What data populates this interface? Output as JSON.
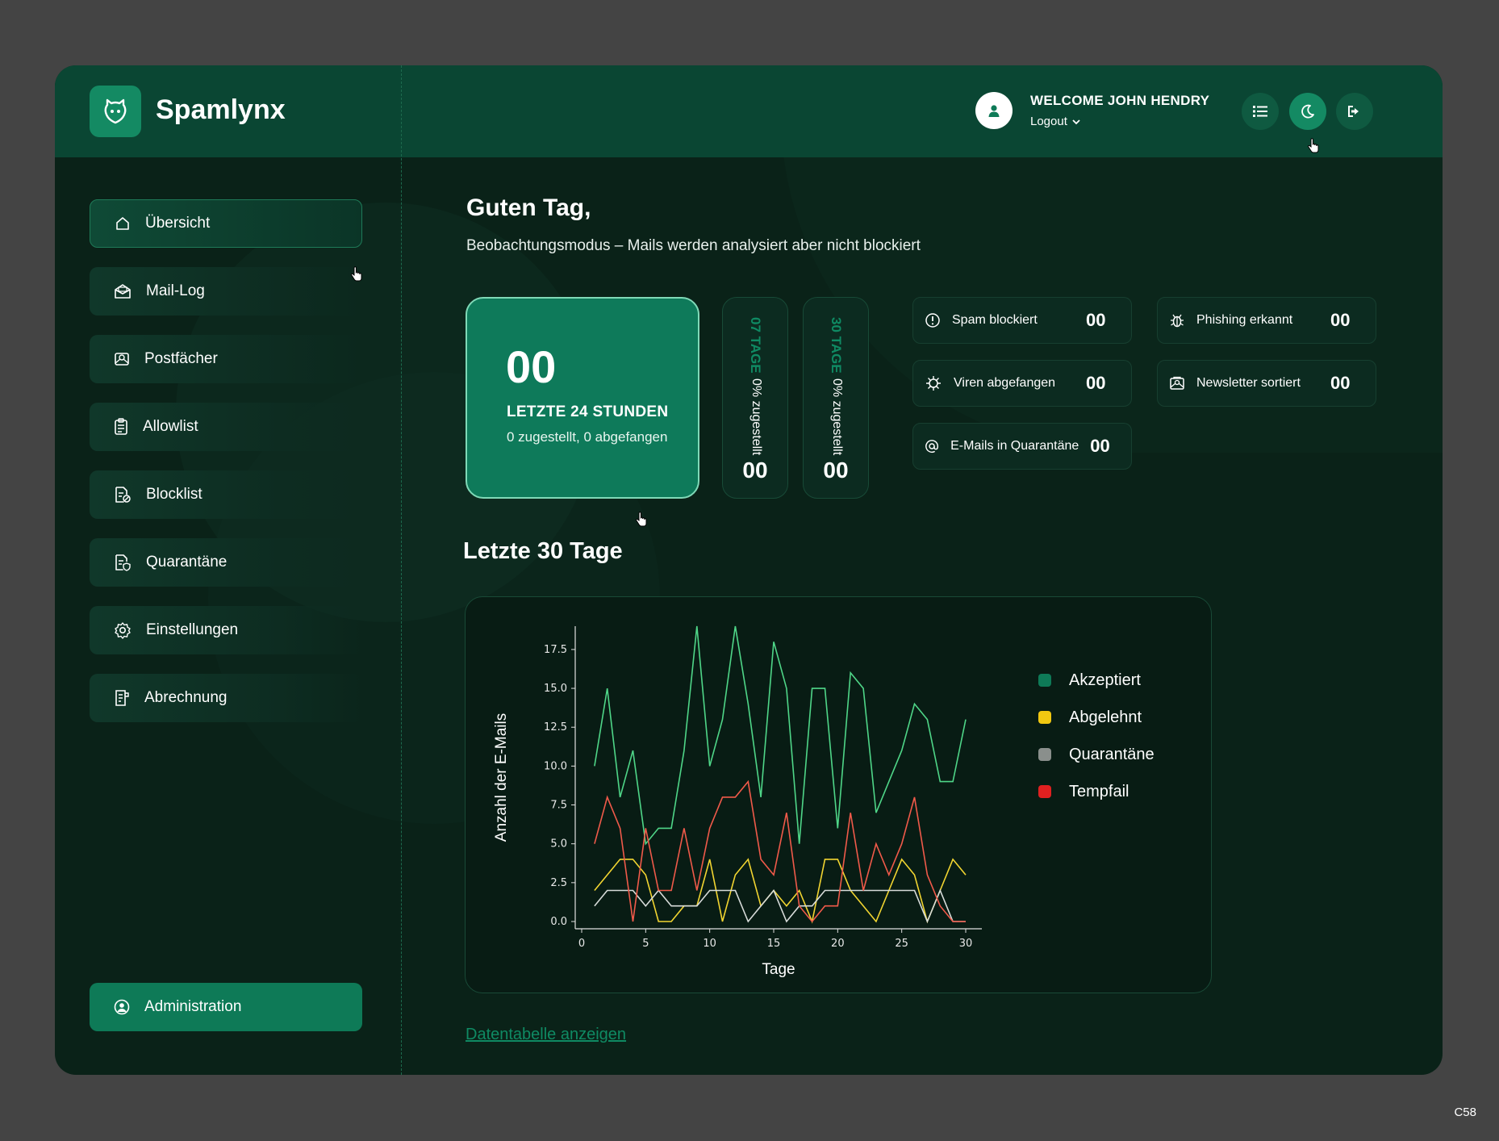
{
  "app": {
    "name": "Spamlynx",
    "welcome": "WELCOME JOHN HENDRY",
    "logout_label": "Logout"
  },
  "header_icons": [
    "list-icon",
    "moon-icon",
    "logout-icon"
  ],
  "sidebar": {
    "items": [
      {
        "label": "Übersicht",
        "icon": "home-icon",
        "active": true
      },
      {
        "label": "Mail-Log",
        "icon": "mail-open-icon",
        "active": false
      },
      {
        "label": "Postfächer",
        "icon": "mailbox-icon",
        "active": false
      },
      {
        "label": "Allowlist",
        "icon": "checklist-icon",
        "active": false
      },
      {
        "label": "Blocklist",
        "icon": "blocklist-icon",
        "active": false
      },
      {
        "label": "Quarantäne",
        "icon": "quarantine-icon",
        "active": false
      },
      {
        "label": "Einstellungen",
        "icon": "gear-icon",
        "active": false
      },
      {
        "label": "Abrechnung",
        "icon": "billing-icon",
        "active": false
      }
    ],
    "admin_label": "Administration"
  },
  "main": {
    "greeting": "Guten Tag,",
    "subtitle": "Beobachtungsmodus – Mails werden analysiert aber nicht blockiert",
    "summary": {
      "value": "00",
      "label": "LETZTE 24 STUNDEN",
      "sub": "0 zugestellt, 0 abgefangen"
    },
    "period_cards": [
      {
        "days": "07 TAGE",
        "pct": "0% zugestellt",
        "value": "00"
      },
      {
        "days": "30 TAGE",
        "pct": "0% zugestellt",
        "value": "00"
      }
    ],
    "stats": [
      {
        "label": "Spam blockiert",
        "value": "00",
        "icon": "alert-circle-icon"
      },
      {
        "label": "Phishing erkannt",
        "value": "00",
        "icon": "bug-icon"
      },
      {
        "label": "Viren abgefangen",
        "value": "00",
        "icon": "virus-icon"
      },
      {
        "label": "Newsletter sortiert",
        "value": "00",
        "icon": "newsletter-icon"
      },
      {
        "label": "E-Mails in Quarantäne",
        "value": "00",
        "icon": "at-icon"
      }
    ],
    "section_title": "Letzte 30 Tage",
    "data_link": "Datentabelle anzeigen"
  },
  "chart_data": {
    "type": "line",
    "xlabel": "Tage",
    "ylabel": "Anzahl der E-Mails",
    "xlim": [
      0,
      30
    ],
    "ylim": [
      0,
      19
    ],
    "x_ticks": [
      0,
      5,
      10,
      15,
      20,
      25,
      30
    ],
    "y_ticks": [
      "0.0",
      "2.5",
      "5.0",
      "7.5",
      "10.0",
      "12.5",
      "15.0",
      "17.5"
    ],
    "legend_position": "right",
    "x": [
      1,
      2,
      3,
      4,
      5,
      6,
      7,
      8,
      9,
      10,
      11,
      12,
      13,
      14,
      15,
      16,
      17,
      18,
      19,
      20,
      21,
      22,
      23,
      24,
      25,
      26,
      27,
      28,
      29,
      30
    ],
    "series": [
      {
        "name": "Akzeptiert",
        "legend_color": "#0e7a57",
        "line_color": "#4fd688",
        "values": [
          10,
          15,
          8,
          11,
          5,
          6,
          6,
          11,
          19,
          10,
          13,
          19,
          14,
          8,
          18,
          15,
          5,
          15,
          15,
          6,
          16,
          15,
          7,
          9,
          11,
          14,
          13,
          9,
          9,
          13
        ]
      },
      {
        "name": "Abgelehnt",
        "legend_color": "#f2c811",
        "line_color": "#f2d531",
        "values": [
          2,
          3,
          4,
          4,
          3,
          0,
          0,
          1,
          1,
          4,
          0,
          3,
          4,
          1,
          2,
          1,
          2,
          0,
          4,
          4,
          2,
          1,
          0,
          2,
          4,
          3,
          0,
          2,
          4,
          3
        ]
      },
      {
        "name": "Quarantäne",
        "legend_color": "#8a8f8c",
        "line_color": "#d8dcda",
        "values": [
          1,
          2,
          2,
          2,
          1,
          2,
          1,
          1,
          1,
          2,
          2,
          2,
          0,
          1,
          2,
          0,
          1,
          1,
          2,
          2,
          2,
          2,
          2,
          2,
          2,
          2,
          0,
          2,
          0,
          0
        ]
      },
      {
        "name": "Tempfail",
        "legend_color": "#e02020",
        "line_color": "#f05a4a",
        "values": [
          5,
          8,
          6,
          0,
          6,
          2,
          2,
          6,
          2,
          6,
          8,
          8,
          9,
          4,
          3,
          7,
          1,
          0,
          1,
          1,
          7,
          2,
          5,
          3,
          5,
          8,
          3,
          1,
          0,
          0
        ]
      }
    ]
  },
  "corner_tag": "C58"
}
